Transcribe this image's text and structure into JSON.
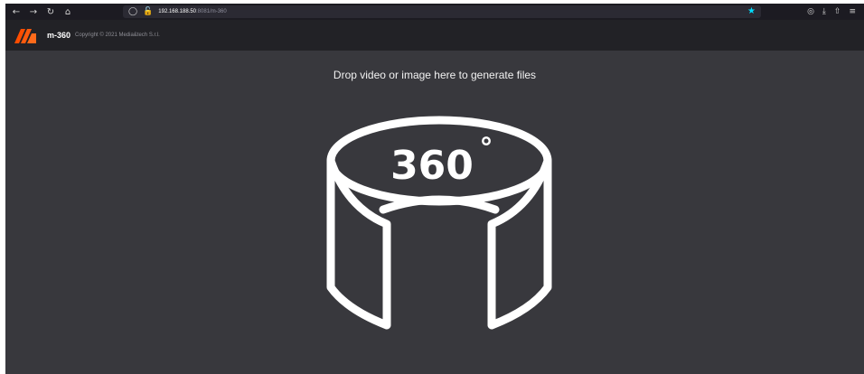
{
  "browser": {
    "nav": {
      "back_icon": "←",
      "forward_icon": "→",
      "reload_icon": "↻",
      "home_icon": "⌂"
    },
    "url": {
      "host": "192.168.188.50",
      "rest": ":8081/m-360"
    },
    "bookmark_icon": "★",
    "bookmark_color": "#00ddff",
    "tools": {
      "pocket_icon": "◎",
      "download_icon": "⤓",
      "extensions_icon": "⇧",
      "menu_icon": "≡"
    }
  },
  "app": {
    "title": "m-360",
    "copyright": "Copyright © 2021 Media&tech S.r.l.",
    "brand_color": "#ff4d00"
  },
  "main": {
    "drop_text": "Drop video or image here to generate files",
    "logo_text": "360",
    "degree_symbol": "°"
  }
}
